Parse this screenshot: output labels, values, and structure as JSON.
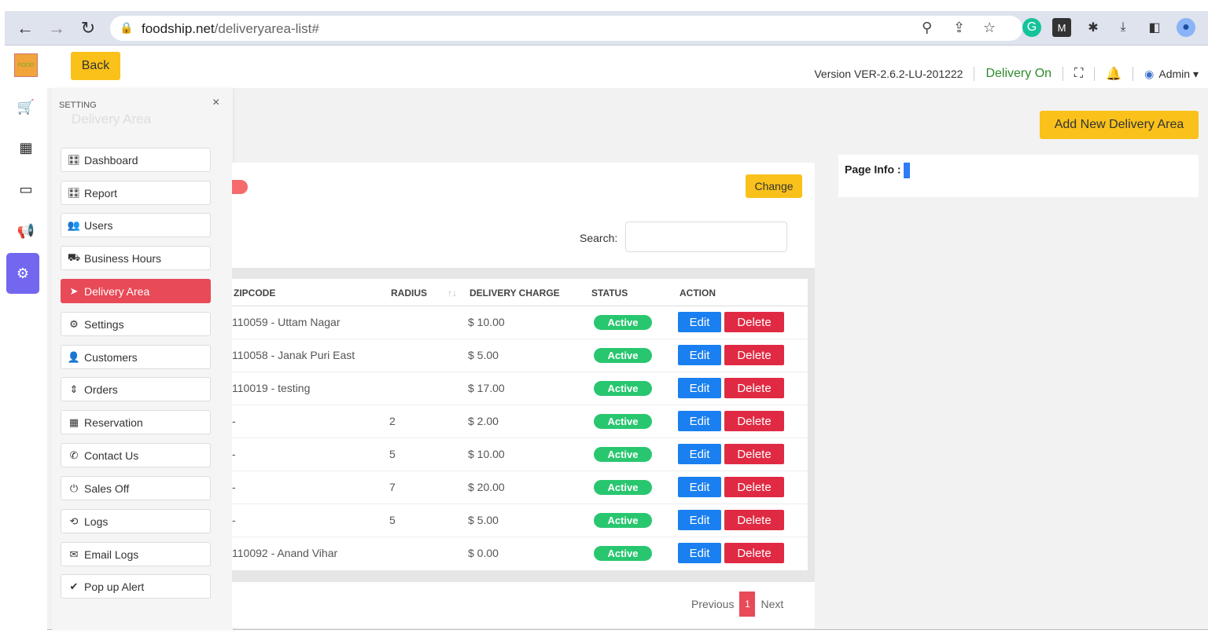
{
  "browser": {
    "url_host": "foodship.net",
    "url_path": "/deliveryarea-list#"
  },
  "topbar": {
    "back_label": "Back",
    "version": "Version VER-2.6.2-LU-201222",
    "delivery_status": "Delivery On",
    "admin_label": "Admin ▾"
  },
  "panel": {
    "title": "SETTING",
    "ghost_title": "Delivery Area",
    "close": "×",
    "items": [
      {
        "label": "Dashboard",
        "icon": "🎛"
      },
      {
        "label": "Report",
        "icon": "🎛"
      },
      {
        "label": "Users",
        "icon": "👥"
      },
      {
        "label": "Business Hours",
        "icon": "⛟"
      },
      {
        "label": "Delivery Area",
        "icon": "➤"
      },
      {
        "label": "Settings",
        "icon": "⚙"
      },
      {
        "label": "Customers",
        "icon": "👤"
      },
      {
        "label": "Orders",
        "icon": "⇕"
      },
      {
        "label": "Reservation",
        "icon": "▦"
      },
      {
        "label": "Contact Us",
        "icon": "✆"
      },
      {
        "label": "Sales Off",
        "icon": "⏻"
      },
      {
        "label": "Logs",
        "icon": "⟲"
      },
      {
        "label": "Email Logs",
        "icon": "✉"
      },
      {
        "label": "Pop up Alert",
        "icon": "✔"
      }
    ]
  },
  "main": {
    "add_button": "Add New Delivery Area",
    "page_info_label": "Page Info :",
    "change_button": "Change",
    "search_label": "Search:",
    "columns": [
      "ZIPCODE",
      "RADIUS",
      "DELIVERY CHARGE",
      "STATUS",
      "ACTION"
    ],
    "sort_glyph": "↑↓",
    "edit_label": "Edit",
    "delete_label": "Delete",
    "rows": [
      {
        "zipcode": "110059 - Uttam Nagar",
        "radius": "",
        "charge": "$ 10.00",
        "status": "Active"
      },
      {
        "zipcode": "110058 - Janak Puri East",
        "radius": "",
        "charge": "$ 5.00",
        "status": "Active"
      },
      {
        "zipcode": "110019 - testing",
        "radius": "",
        "charge": "$ 17.00",
        "status": "Active"
      },
      {
        "zipcode": "-",
        "radius": "2",
        "charge": "$ 2.00",
        "status": "Active"
      },
      {
        "zipcode": "-",
        "radius": "5",
        "charge": "$ 10.00",
        "status": "Active"
      },
      {
        "zipcode": "-",
        "radius": "7",
        "charge": "$ 20.00",
        "status": "Active"
      },
      {
        "zipcode": "-",
        "radius": "5",
        "charge": "$ 5.00",
        "status": "Active"
      },
      {
        "zipcode": "110092 - Anand Vihar",
        "radius": "",
        "charge": "$ 0.00",
        "status": "Active"
      }
    ],
    "pager": {
      "previous": "Previous",
      "current": "1",
      "next": "Next"
    }
  }
}
